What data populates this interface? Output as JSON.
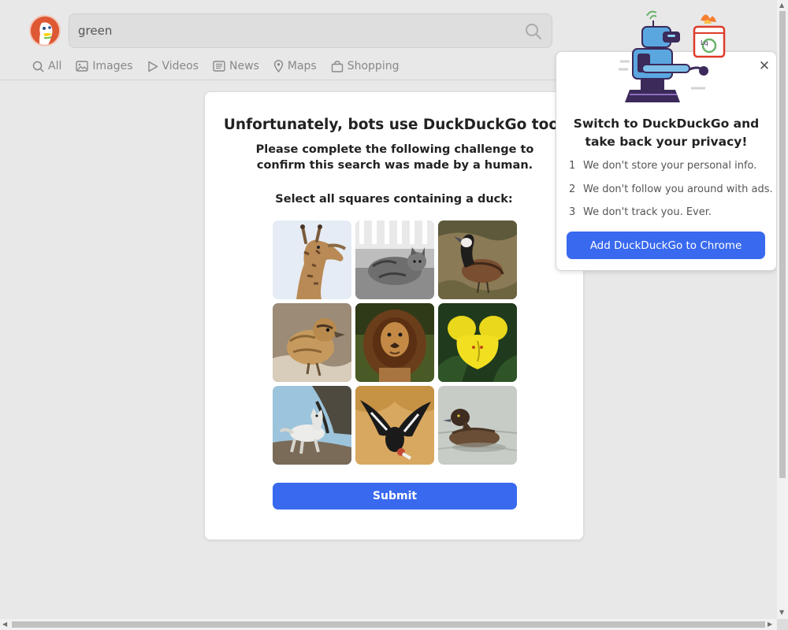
{
  "search": {
    "query": "green"
  },
  "nav": {
    "items": [
      {
        "label": "All",
        "icon": "search-icon"
      },
      {
        "label": "Images",
        "icon": "image-icon"
      },
      {
        "label": "Videos",
        "icon": "play-icon"
      },
      {
        "label": "News",
        "icon": "newspaper-icon"
      },
      {
        "label": "Maps",
        "icon": "map-pin-icon"
      },
      {
        "label": "Shopping",
        "icon": "shopping-bag-icon"
      }
    ]
  },
  "challenge": {
    "title": "Unfortunately, bots use DuckDuckGo too.",
    "subtitle": "Please complete the following challenge to confirm this search was made by a human.",
    "instruction": "Select all squares containing a duck:",
    "tiles": [
      {
        "subject": "giraffe"
      },
      {
        "subject": "cat (black and white)"
      },
      {
        "subject": "duck"
      },
      {
        "subject": "duckling"
      },
      {
        "subject": "lion"
      },
      {
        "subject": "yellow flower"
      },
      {
        "subject": "white dog"
      },
      {
        "subject": "condor"
      },
      {
        "subject": "duck on water"
      }
    ],
    "submit_label": "Submit"
  },
  "promo": {
    "close_glyph": "✕",
    "title_line1": "Switch to DuckDuckGo and",
    "title_line2": "take back your privacy!",
    "points": [
      {
        "num": "1",
        "text": "We don't store your personal info."
      },
      {
        "num": "2",
        "text": "We don't follow you around with ads."
      },
      {
        "num": "3",
        "text": "We don't track you. Ever."
      }
    ],
    "cta_label": "Add DuckDuckGo to Chrome"
  },
  "colors": {
    "accent": "#3969ef",
    "page_background": "#e8e8e8",
    "brand_orange": "#de5833"
  }
}
